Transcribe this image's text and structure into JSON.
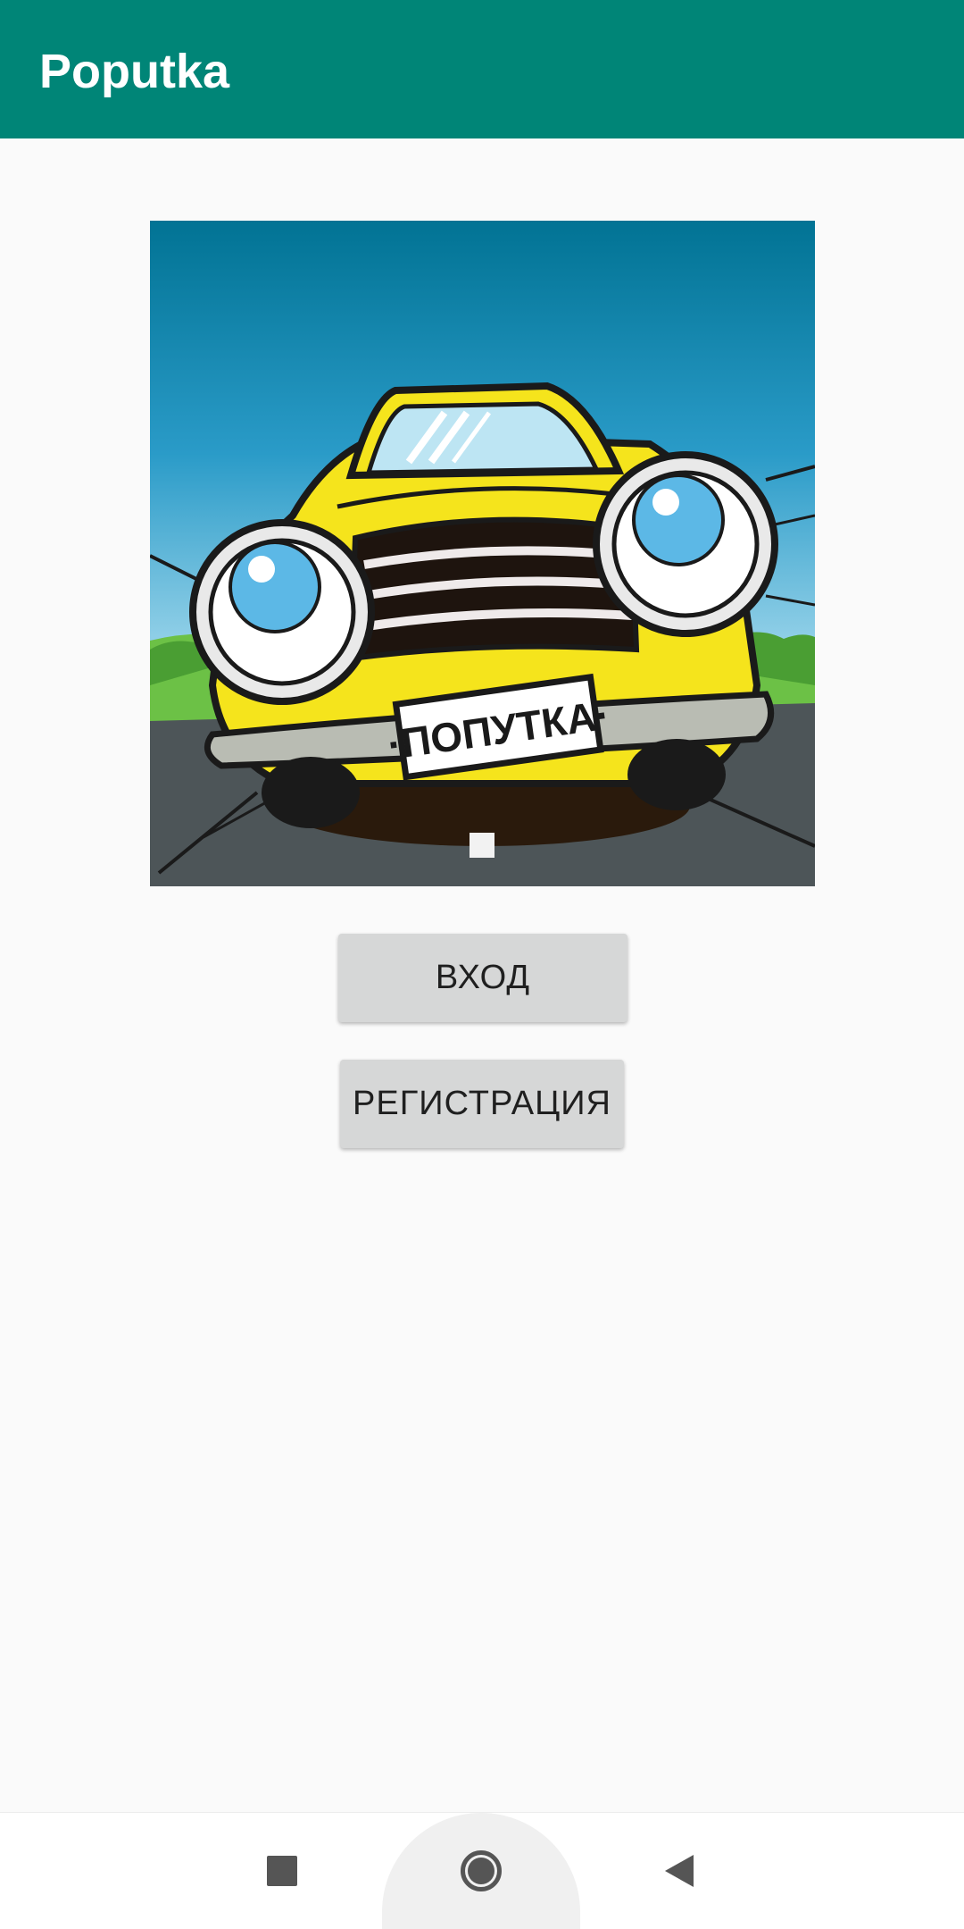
{
  "app_bar": {
    "title": "Poputka",
    "color": "#008577"
  },
  "main": {
    "hero_image": {
      "plate_text": "·ПОПУТКА·",
      "description_icon": "cartoon-car-image"
    },
    "buttons": {
      "login_label": "ВХОД",
      "register_label": "РЕГИСТРАЦИЯ"
    }
  },
  "nav_bar": {
    "recents_icon": "square-icon",
    "home_icon": "circle-icon",
    "back_icon": "triangle-back-icon"
  }
}
